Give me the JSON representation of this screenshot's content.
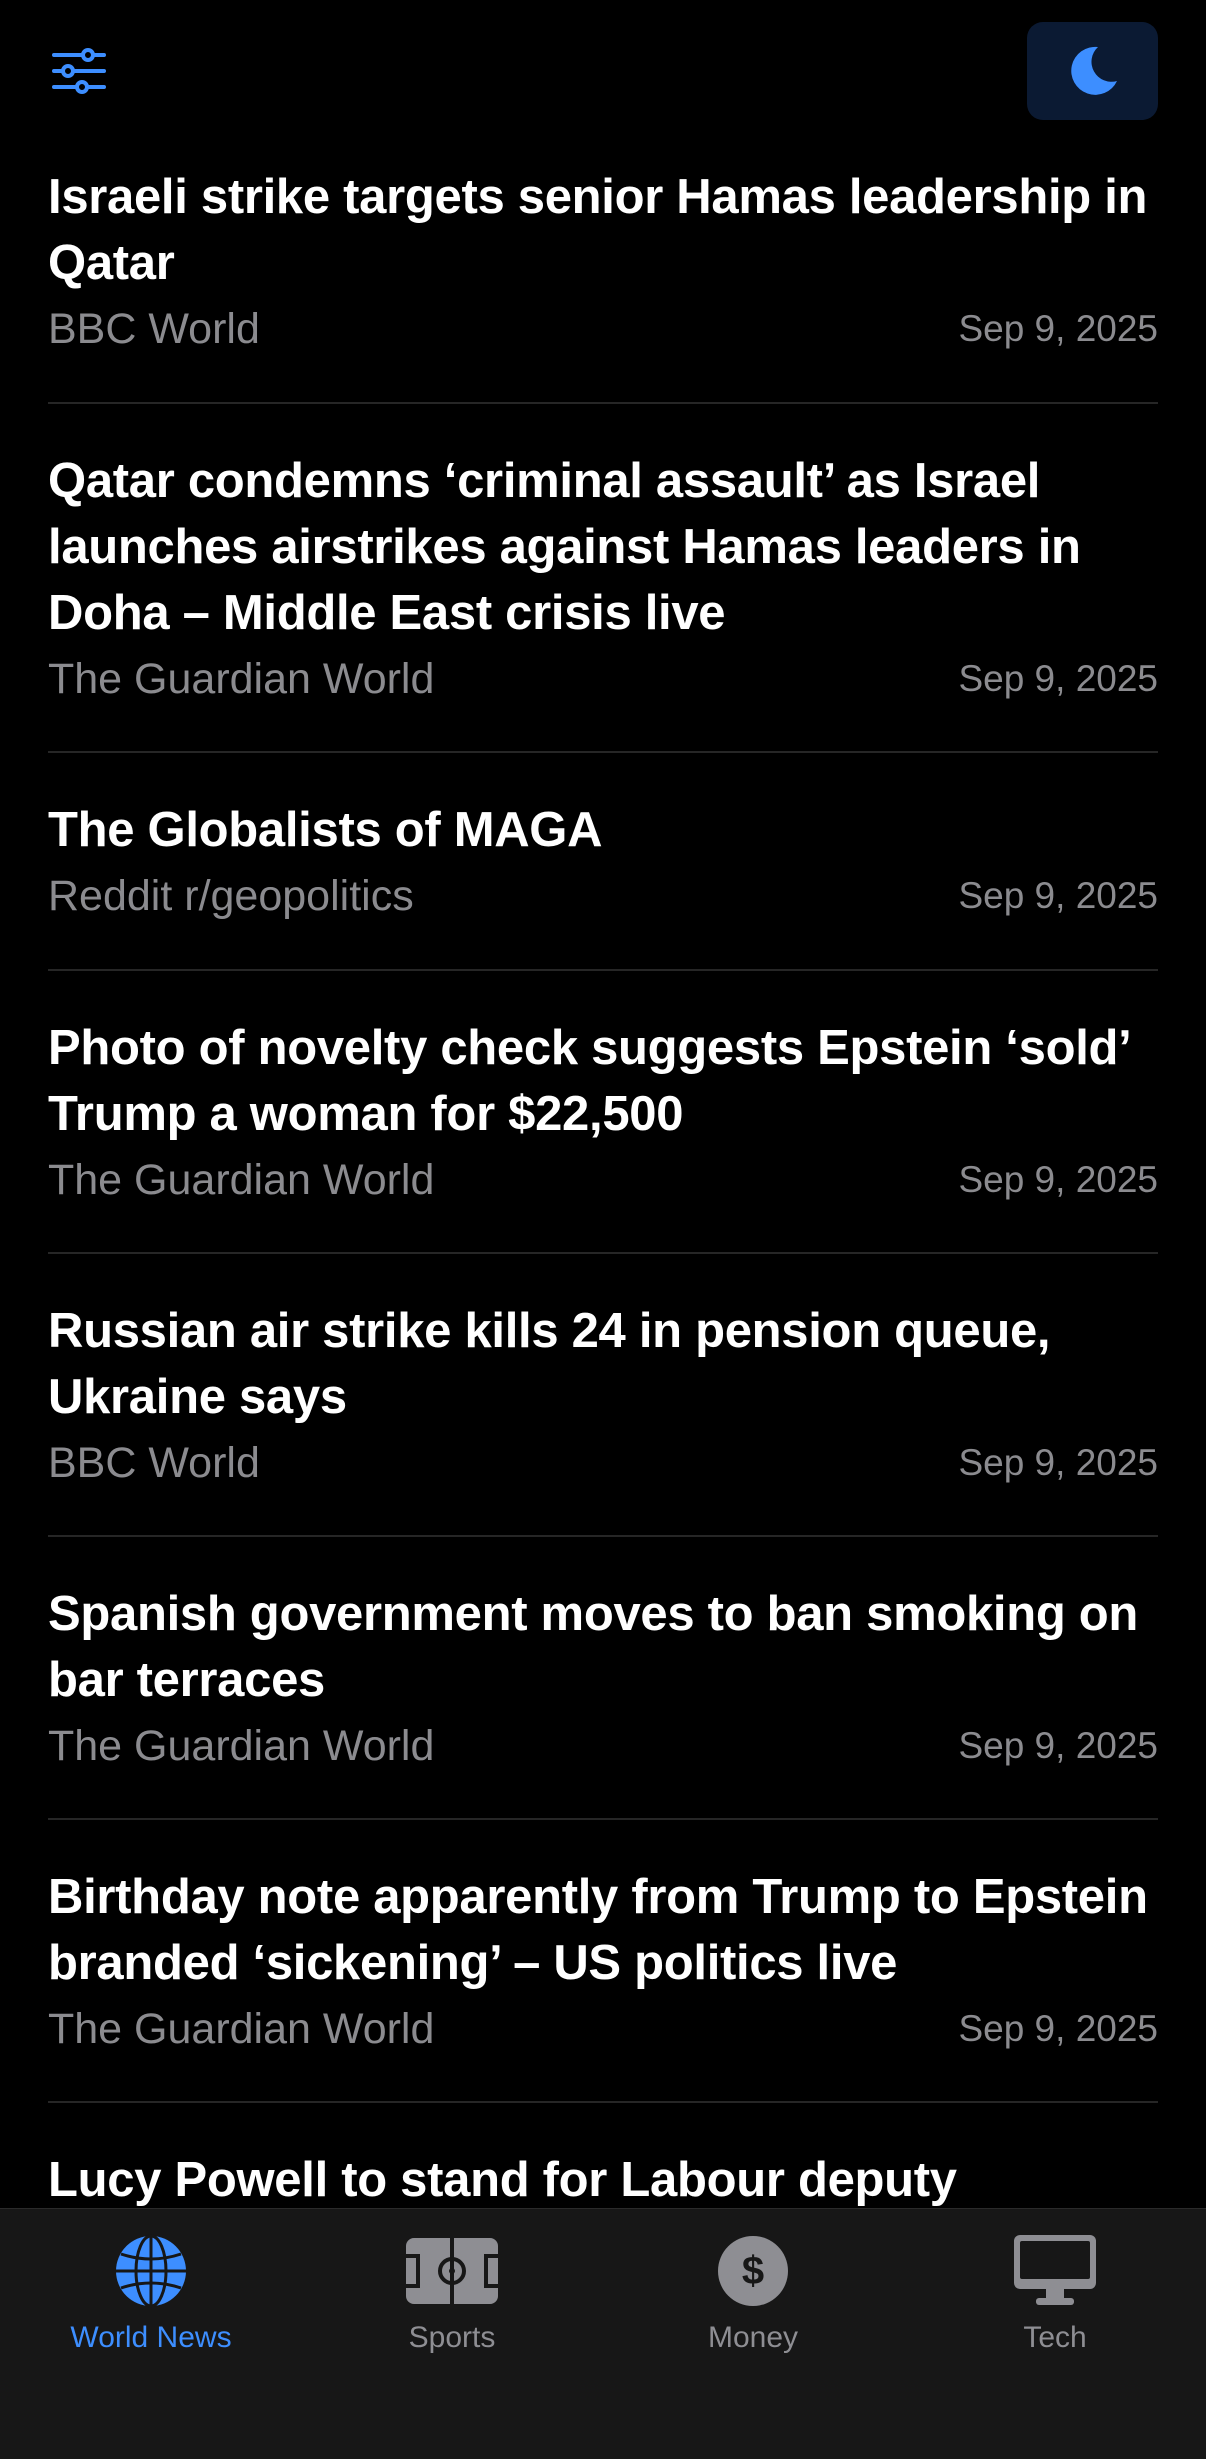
{
  "header": {
    "filter_icon": "sliders-icon",
    "theme_icon": "moon-icon",
    "accent_color": "#3d8eff"
  },
  "articles": [
    {
      "title": "Israeli strike targets senior Hamas leadership in Qatar",
      "source": "BBC World",
      "date": "Sep 9, 2025"
    },
    {
      "title": "Qatar condemns ‘criminal assault’ as Israel launches airstrikes against Hamas leaders in Doha – Middle East crisis live",
      "source": "The Guardian World",
      "date": "Sep 9, 2025"
    },
    {
      "title": "The Globalists of MAGA",
      "source": "Reddit r/geopolitics",
      "date": "Sep 9, 2025"
    },
    {
      "title": "Photo of novelty check suggests Epstein ‘sold’ Trump a woman for $22,500",
      "source": "The Guardian World",
      "date": "Sep 9, 2025"
    },
    {
      "title": "Russian air strike kills 24 in pension queue, Ukraine says",
      "source": "BBC World",
      "date": "Sep 9, 2025"
    },
    {
      "title": "Spanish government moves to ban smoking on bar terraces",
      "source": "The Guardian World",
      "date": "Sep 9, 2025"
    },
    {
      "title": "Birthday note apparently from Trump to Epstein branded ‘sickening’ – US politics live",
      "source": "The Guardian World",
      "date": "Sep 9, 2025"
    },
    {
      "title": "Lucy Powell to stand for Labour deputy",
      "source": "",
      "date": ""
    }
  ],
  "tabs": [
    {
      "label": "World News",
      "icon": "globe-icon",
      "active": true
    },
    {
      "label": "Sports",
      "icon": "soccer-field-icon",
      "active": false
    },
    {
      "label": "Money",
      "icon": "dollar-icon",
      "active": false
    },
    {
      "label": "Tech",
      "icon": "desktop-icon",
      "active": false
    }
  ]
}
